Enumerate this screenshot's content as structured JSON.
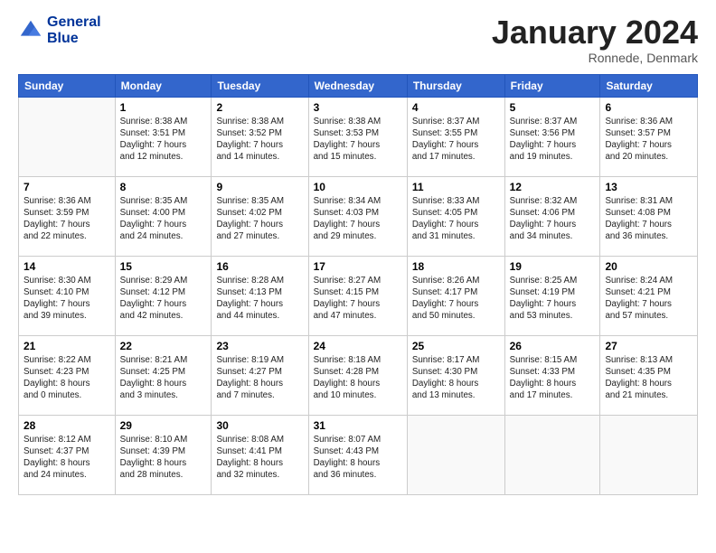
{
  "header": {
    "logo_line1": "General",
    "logo_line2": "Blue",
    "month_title": "January 2024",
    "location": "Ronnede, Denmark"
  },
  "weekdays": [
    "Sunday",
    "Monday",
    "Tuesday",
    "Wednesday",
    "Thursday",
    "Friday",
    "Saturday"
  ],
  "weeks": [
    [
      {
        "day": "",
        "info": ""
      },
      {
        "day": "1",
        "info": "Sunrise: 8:38 AM\nSunset: 3:51 PM\nDaylight: 7 hours\nand 12 minutes."
      },
      {
        "day": "2",
        "info": "Sunrise: 8:38 AM\nSunset: 3:52 PM\nDaylight: 7 hours\nand 14 minutes."
      },
      {
        "day": "3",
        "info": "Sunrise: 8:38 AM\nSunset: 3:53 PM\nDaylight: 7 hours\nand 15 minutes."
      },
      {
        "day": "4",
        "info": "Sunrise: 8:37 AM\nSunset: 3:55 PM\nDaylight: 7 hours\nand 17 minutes."
      },
      {
        "day": "5",
        "info": "Sunrise: 8:37 AM\nSunset: 3:56 PM\nDaylight: 7 hours\nand 19 minutes."
      },
      {
        "day": "6",
        "info": "Sunrise: 8:36 AM\nSunset: 3:57 PM\nDaylight: 7 hours\nand 20 minutes."
      }
    ],
    [
      {
        "day": "7",
        "info": "Sunrise: 8:36 AM\nSunset: 3:59 PM\nDaylight: 7 hours\nand 22 minutes."
      },
      {
        "day": "8",
        "info": "Sunrise: 8:35 AM\nSunset: 4:00 PM\nDaylight: 7 hours\nand 24 minutes."
      },
      {
        "day": "9",
        "info": "Sunrise: 8:35 AM\nSunset: 4:02 PM\nDaylight: 7 hours\nand 27 minutes."
      },
      {
        "day": "10",
        "info": "Sunrise: 8:34 AM\nSunset: 4:03 PM\nDaylight: 7 hours\nand 29 minutes."
      },
      {
        "day": "11",
        "info": "Sunrise: 8:33 AM\nSunset: 4:05 PM\nDaylight: 7 hours\nand 31 minutes."
      },
      {
        "day": "12",
        "info": "Sunrise: 8:32 AM\nSunset: 4:06 PM\nDaylight: 7 hours\nand 34 minutes."
      },
      {
        "day": "13",
        "info": "Sunrise: 8:31 AM\nSunset: 4:08 PM\nDaylight: 7 hours\nand 36 minutes."
      }
    ],
    [
      {
        "day": "14",
        "info": "Sunrise: 8:30 AM\nSunset: 4:10 PM\nDaylight: 7 hours\nand 39 minutes."
      },
      {
        "day": "15",
        "info": "Sunrise: 8:29 AM\nSunset: 4:12 PM\nDaylight: 7 hours\nand 42 minutes."
      },
      {
        "day": "16",
        "info": "Sunrise: 8:28 AM\nSunset: 4:13 PM\nDaylight: 7 hours\nand 44 minutes."
      },
      {
        "day": "17",
        "info": "Sunrise: 8:27 AM\nSunset: 4:15 PM\nDaylight: 7 hours\nand 47 minutes."
      },
      {
        "day": "18",
        "info": "Sunrise: 8:26 AM\nSunset: 4:17 PM\nDaylight: 7 hours\nand 50 minutes."
      },
      {
        "day": "19",
        "info": "Sunrise: 8:25 AM\nSunset: 4:19 PM\nDaylight: 7 hours\nand 53 minutes."
      },
      {
        "day": "20",
        "info": "Sunrise: 8:24 AM\nSunset: 4:21 PM\nDaylight: 7 hours\nand 57 minutes."
      }
    ],
    [
      {
        "day": "21",
        "info": "Sunrise: 8:22 AM\nSunset: 4:23 PM\nDaylight: 8 hours\nand 0 minutes."
      },
      {
        "day": "22",
        "info": "Sunrise: 8:21 AM\nSunset: 4:25 PM\nDaylight: 8 hours\nand 3 minutes."
      },
      {
        "day": "23",
        "info": "Sunrise: 8:19 AM\nSunset: 4:27 PM\nDaylight: 8 hours\nand 7 minutes."
      },
      {
        "day": "24",
        "info": "Sunrise: 8:18 AM\nSunset: 4:28 PM\nDaylight: 8 hours\nand 10 minutes."
      },
      {
        "day": "25",
        "info": "Sunrise: 8:17 AM\nSunset: 4:30 PM\nDaylight: 8 hours\nand 13 minutes."
      },
      {
        "day": "26",
        "info": "Sunrise: 8:15 AM\nSunset: 4:33 PM\nDaylight: 8 hours\nand 17 minutes."
      },
      {
        "day": "27",
        "info": "Sunrise: 8:13 AM\nSunset: 4:35 PM\nDaylight: 8 hours\nand 21 minutes."
      }
    ],
    [
      {
        "day": "28",
        "info": "Sunrise: 8:12 AM\nSunset: 4:37 PM\nDaylight: 8 hours\nand 24 minutes."
      },
      {
        "day": "29",
        "info": "Sunrise: 8:10 AM\nSunset: 4:39 PM\nDaylight: 8 hours\nand 28 minutes."
      },
      {
        "day": "30",
        "info": "Sunrise: 8:08 AM\nSunset: 4:41 PM\nDaylight: 8 hours\nand 32 minutes."
      },
      {
        "day": "31",
        "info": "Sunrise: 8:07 AM\nSunset: 4:43 PM\nDaylight: 8 hours\nand 36 minutes."
      },
      {
        "day": "",
        "info": ""
      },
      {
        "day": "",
        "info": ""
      },
      {
        "day": "",
        "info": ""
      }
    ]
  ]
}
